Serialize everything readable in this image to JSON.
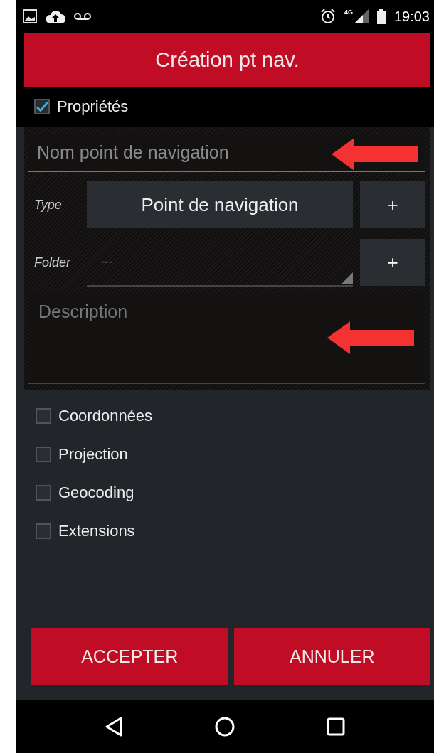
{
  "status_bar": {
    "time": "19:03",
    "network": "4G"
  },
  "title": "Création pt nav.",
  "properties": {
    "label": "Propriétés",
    "checked": true
  },
  "form": {
    "name": {
      "placeholder": "Nom point de navigation",
      "focused": true
    },
    "type": {
      "label": "Type",
      "value": "Point de navigation",
      "add": "+"
    },
    "folder": {
      "label": "Folder",
      "value": "---",
      "add": "+"
    },
    "description": {
      "placeholder": "Description"
    }
  },
  "sections": [
    {
      "label": "Coordonnées",
      "checked": false
    },
    {
      "label": "Projection",
      "checked": false
    },
    {
      "label": "Geocoding",
      "checked": false
    },
    {
      "label": "Extensions",
      "checked": false
    }
  ],
  "buttons": [
    "ACCEPTER",
    "ANNULER"
  ]
}
